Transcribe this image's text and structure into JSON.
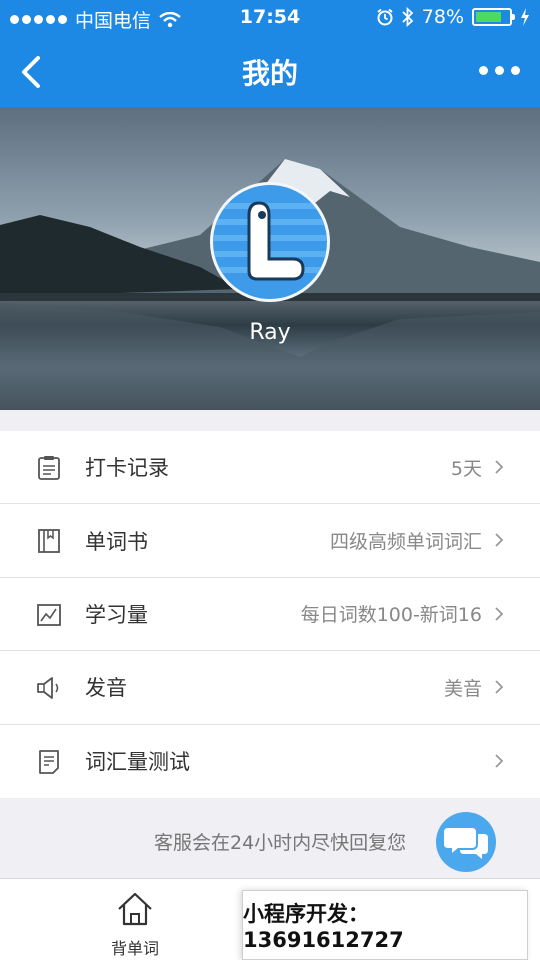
{
  "status_bar": {
    "carrier": "中国电信",
    "time": "17:54",
    "battery": "78%",
    "battery_level": 0.78
  },
  "nav": {
    "title": "我的",
    "back_icon": "chevron-left-icon",
    "more_icon": "more-dots-icon"
  },
  "profile": {
    "name": "Ray",
    "avatar_letter": "L"
  },
  "menu": [
    {
      "label": "打卡记录",
      "value": "5天",
      "icon": "clipboard-icon"
    },
    {
      "label": "单词书",
      "value": "四级高频单词词汇",
      "icon": "book-icon"
    },
    {
      "label": "学习量",
      "value": "每日词数100-新词16",
      "icon": "chart-icon"
    },
    {
      "label": "发音",
      "value": "美音",
      "icon": "speaker-icon"
    },
    {
      "label": "词汇量测试",
      "value": "",
      "icon": "test-paper-icon"
    }
  ],
  "service": {
    "text": "客服会在24小时内尽快回复您",
    "icon": "chat-bubbles-icon"
  },
  "tabbar": {
    "tabs": [
      {
        "label": "背单词",
        "icon": "home-icon"
      }
    ]
  },
  "promo": {
    "text": "小程序开发：13691612727"
  },
  "colors": {
    "primary": "#1e88e5",
    "battery_green": "#4cd964",
    "fab": "#4ba8ec"
  }
}
